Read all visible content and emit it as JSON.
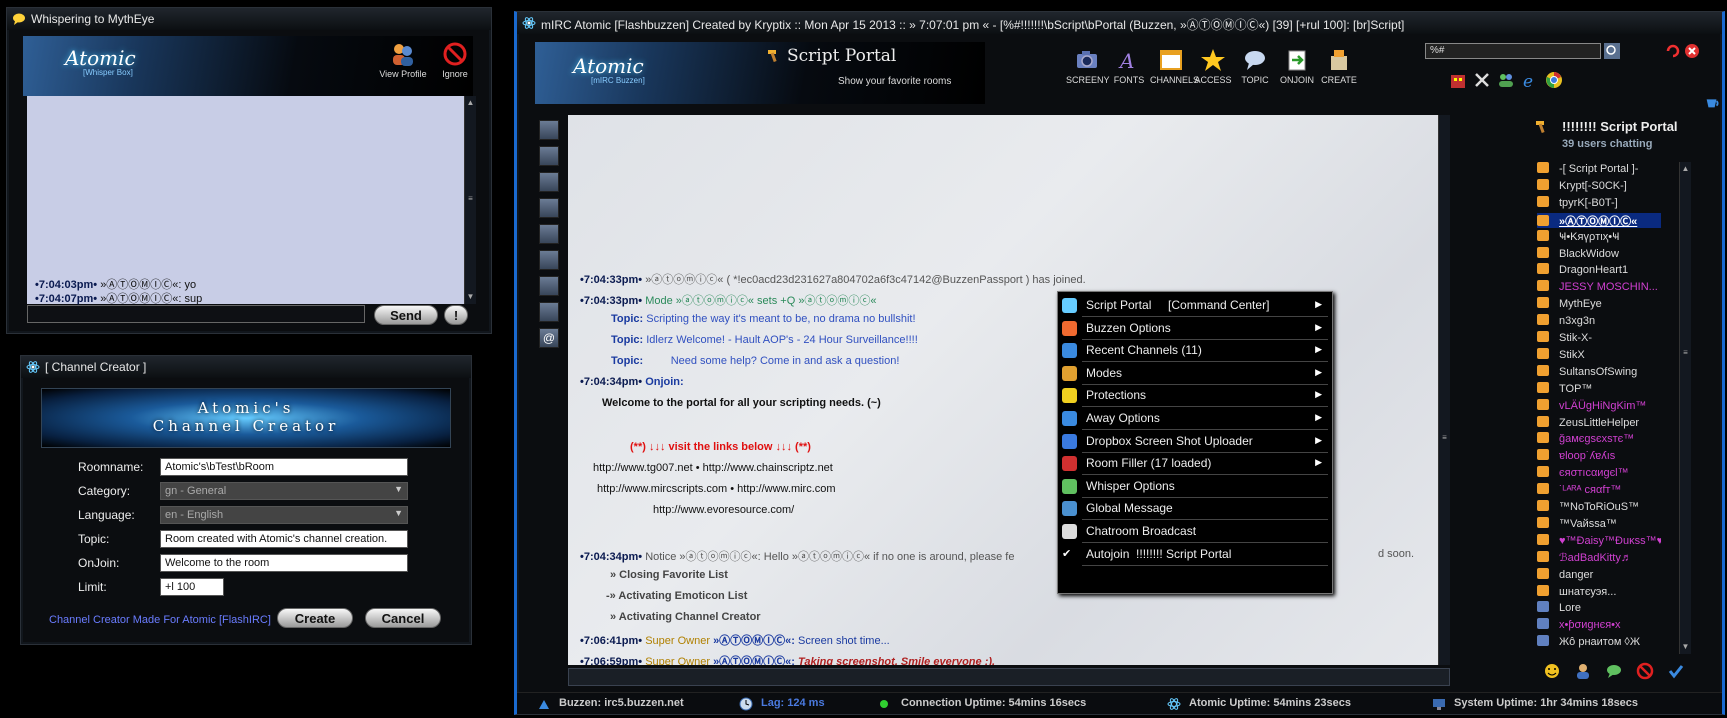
{
  "whisper": {
    "title": "Whispering to MythEye",
    "logo_main": "Atomic",
    "logo_sub": "[Whisper Box]",
    "view_profile": "View Profile",
    "ignore": "Ignore",
    "lines": [
      {
        "time": "•7:04:03pm•",
        "text": "»ⒶⓉⓄⓂⒾⒸ«: yo"
      },
      {
        "time": "•7:04:07pm•",
        "text": "»ⒶⓉⓄⓂⒾⒸ«: sup"
      }
    ],
    "send": "Send",
    "warn": "!"
  },
  "creator": {
    "title": "[ Channel Creator ]",
    "banner_line1": "Atomic's",
    "banner_line2": "Channel Creator",
    "roomname_label": "Roomname:",
    "roomname_value": "Atomic's\\bTest\\bRoom",
    "category_label": "Category:",
    "category_value": "gn - General",
    "language_label": "Language:",
    "language_value": "en - English",
    "topic_label": "Topic:",
    "topic_value": "Room created with Atomic's channel creation.",
    "onjoin_label": "OnJoin:",
    "onjoin_value": "Welcome to the room",
    "limit_label": "Limit:",
    "limit_value": "+l 100",
    "footer": "Channel Creator Made For Atomic [FlashIRC]",
    "create": "Create",
    "cancel": "Cancel"
  },
  "main": {
    "title": "mIRC Atomic [Flashbuzzen] Created by Kryptix :: Mon Apr 15 2013 :: » 7:07:01 pm « - [%#!!!!!!!\\bScript\\bPortal (Buzzen, »ⒶⓉⓄⓂⒾⒸ«) [39] [+rul 100]: [br]Script]",
    "logo_main": "Atomic",
    "logo_sub": "[mIRC Buzzen]",
    "room_title": "Script Portal",
    "room_subtitle": "Show your favorite rooms",
    "toolbar": [
      "SCREENY",
      "FONTS",
      "CHANNELS",
      "ACCESS",
      "TOPIC",
      "ONJOIN",
      "CREATE"
    ],
    "search_value": "%#",
    "chat": [
      {
        "time": "•7:04:33pm•",
        "text": "»ⓐⓣⓞⓜⓘⓒ« ( *!ec0acd23d231627a804702a6f3c47142@BuzzenPassport ) has joined.",
        "color": "#555"
      },
      {
        "time": "•7:04:33pm•",
        "text": "Mode »ⓐⓣⓞⓜⓘⓒ« sets +Q »ⓐⓣⓞⓜⓘⓒ«",
        "color": "#2a8a5a"
      }
    ],
    "topics": [
      {
        "label": "Topic:",
        "text": "Scripting the way it's meant to be, no drama no bullshit!"
      },
      {
        "label": "Topic:",
        "text": "Idlerz Welcome! - Hault AOP's - 24 Hour Surveillance!!!!"
      },
      {
        "label": "Topic:",
        "text": "Need some help? Come in and ask a question!"
      }
    ],
    "onjoin_time": "•7:04:34pm•",
    "onjoin_label": "Onjoin:",
    "welcome": "Welcome to the portal for all your scripting needs. (~)",
    "links_header": "(**) ↓↓↓ visit the links below ↓↓↓ (**)",
    "links": [
      "http://www.tg007.net • http://www.chainscriptz.net",
      "http://www.mircscripts.com • http://www.mirc.com",
      "http://www.evoresource.com/"
    ],
    "notice_time": "•7:04:34pm•",
    "notice_text": "Notice »ⓐⓣⓞⓜⓘⓒ«: Hello »ⓐⓣⓞⓜⓘⓒ« if no one is around, please fe",
    "notice_tail": "d soon.",
    "activations": [
      "» Closing Favorite List",
      "-» Activating Emoticon List",
      "» Activating Channel Creator"
    ],
    "owner_lines": [
      {
        "time": "•7:06:41pm•",
        "role": "Super Owner",
        "nick": "»ⒶⓉⓄⓂⒾⒸ«:",
        "text": "Screen shot time...",
        "italic": false
      },
      {
        "time": "•7:06:59pm•",
        "role": "Super Owner",
        "nick": "»ⒶⓉⓄⓂⒾⒸ«:",
        "text": "Taking screenshot, Smile everyone :).",
        "italic": true
      }
    ],
    "menu": [
      {
        "label": "Script Portal     [Command Center]",
        "arrow": true,
        "icon": "atom-icon"
      },
      {
        "label": "Buzzen Options",
        "arrow": true,
        "icon": "flame-icon"
      },
      {
        "label": "Recent Channels (11)",
        "arrow": true,
        "icon": "refresh-icon"
      },
      {
        "label": "Modes",
        "arrow": true,
        "icon": "shapes-icon"
      },
      {
        "label": "Protections",
        "arrow": true,
        "icon": "shield-icon"
      },
      {
        "label": "Away Options",
        "arrow": true,
        "icon": "bed-icon"
      },
      {
        "label": "Dropbox Screen Shot Uploader",
        "arrow": true,
        "icon": "dropbox-icon"
      },
      {
        "label": "Room Filler (17 loaded)",
        "arrow": true,
        "icon": "skull-icon"
      },
      {
        "label": "Whisper Options",
        "arrow": false,
        "icon": "chat-bubble-icon"
      },
      {
        "label": "Global Message",
        "arrow": false,
        "icon": "globe-icon"
      },
      {
        "label": "Chatroom Broadcast",
        "arrow": false,
        "icon": "megaphone-icon"
      },
      {
        "label": "Autojoin  !!!!!!!! Script Portal",
        "arrow": false,
        "icon": "checkmark-icon"
      }
    ],
    "nicklist_title": "!!!!!!!! Script Portal",
    "nicklist_count": "39 users chatting",
    "users": [
      {
        "name": "-[ Script Portal ]-",
        "color": "#ddd"
      },
      {
        "name": "Krypt[-S0CK-]",
        "color": "#ddd"
      },
      {
        "name": "tpyrK[-B0T-]",
        "color": "#ddd"
      },
      {
        "name": "»ⒶⓉⓄⓂⒾⒸ«",
        "color": "#fff"
      },
      {
        "name": "Ҹ•Kяүρтιҳ•Ҹ",
        "color": "#ddd"
      },
      {
        "name": "BlackWidow",
        "color": "#ddd"
      },
      {
        "name": "DragonHeart1",
        "color": "#ddd"
      },
      {
        "name": "JESSY MOSCHIN...",
        "color": "#d040d0"
      },
      {
        "name": "MythEye",
        "color": "#ddd"
      },
      {
        "name": "n3xg3n",
        "color": "#ddd"
      },
      {
        "name": "Stik-X-",
        "color": "#ddd"
      },
      {
        "name": "StikX",
        "color": "#ddd"
      },
      {
        "name": "SultansOfSwing",
        "color": "#ddd"
      },
      {
        "name": "TOP™",
        "color": "#ddd"
      },
      {
        "name": "vLÄÜgHiNgKim™",
        "color": "#d040d0"
      },
      {
        "name": "ZeusLittleHelper",
        "color": "#ddd"
      },
      {
        "name": "ğaмєgѕєxѕтє™",
        "color": "#d040d0"
      },
      {
        "name": "ɐloop˙ʎɐʎıs",
        "color": "#d040d0"
      },
      {
        "name": "єяσтıcαиgєl™",
        "color": "#d040d0"
      },
      {
        "name": "˙ᴸᴬᴿᴬ cяαfт™",
        "color": "#d040d0"
      },
      {
        "name": "™NoToRiOuS™",
        "color": "#ddd"
      },
      {
        "name": "™Vaйssa™",
        "color": "#ddd"
      },
      {
        "name": "♥™Ðaisy™Ðuĸss™♥",
        "color": "#d040d0"
      },
      {
        "name": "ℬadBadKitty♬",
        "color": "#d040d0"
      },
      {
        "name": "danger",
        "color": "#ddd"
      },
      {
        "name": "шнатєуэя...",
        "color": "#ddd"
      },
      {
        "name": "Lore",
        "color": "#ddd"
      },
      {
        "name": "x•ƥσиgнєя•x",
        "color": "#d040d0"
      },
      {
        "name": "Жô рнаитом ◊Ж",
        "color": "#ddd"
      }
    ],
    "status": {
      "server": "Buzzen: irc5.buzzen.net",
      "lag": "Lag: 124 ms",
      "conn": "Connection Uptime: 54mins 16secs",
      "atomic": "Atomic Uptime: 54mins 23secs",
      "system": "System Uptime: 1hr 34mins 18secs"
    }
  }
}
